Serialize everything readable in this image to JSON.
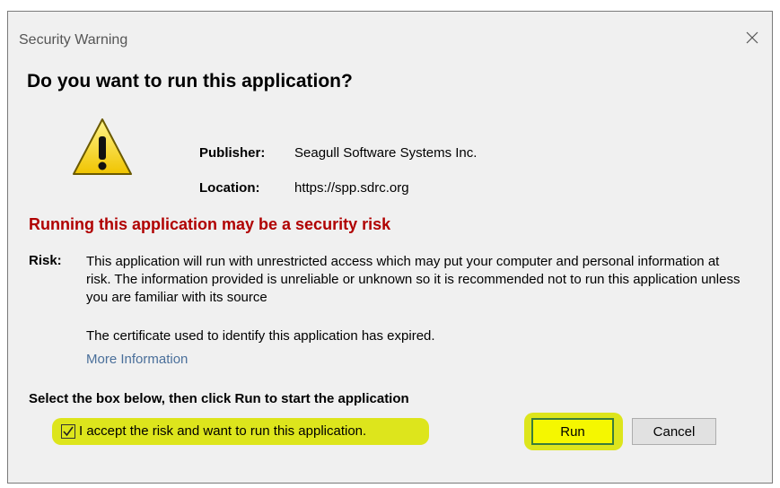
{
  "window": {
    "title": "Security Warning",
    "close_icon": "close-icon"
  },
  "heading": "Do you want to run this application?",
  "publisher": {
    "label": "Publisher:",
    "value": "Seagull Software Systems Inc."
  },
  "location": {
    "label": "Location:",
    "value": "https://spp.sdrc.org"
  },
  "risk_heading": "Running this application may be a security risk",
  "risk": {
    "label": "Risk:",
    "text": "This application will run with unrestricted access which may put your computer and personal information at risk. The information provided is unreliable or unknown so it is recommended not to run this application unless you are familiar with its source",
    "certificate": "The certificate used to identify this application has expired.",
    "more_info": "More Information"
  },
  "instruction": "Select the box below, then click Run to start the application",
  "accept": {
    "label": "I accept the risk and want to run this application.",
    "checked": true
  },
  "buttons": {
    "run": "Run",
    "cancel": "Cancel"
  },
  "colors": {
    "risk_heading": "#b00000",
    "link": "#4a6f9a",
    "highlight": "#dde51c",
    "dialog_bg": "#f0f0f0"
  },
  "icons": [
    "warning-icon",
    "close-icon",
    "checkmark-icon"
  ]
}
